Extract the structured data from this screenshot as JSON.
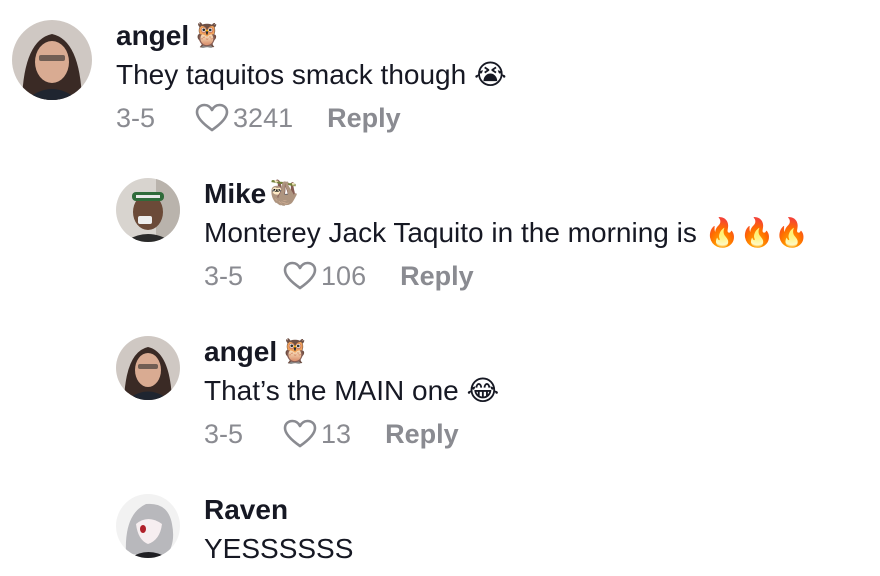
{
  "comments": [
    {
      "username": "angel",
      "badge": "🦉",
      "text": "They taquitos smack though 😭",
      "date": "3-5",
      "likes": "3241",
      "reply_label": "Reply"
    },
    {
      "username": "Mike",
      "badge": "🦥",
      "text": "Monterey Jack Taquito in the morning is 🔥🔥🔥",
      "date": "3-5",
      "likes": "106",
      "reply_label": "Reply"
    },
    {
      "username": "angel",
      "badge": "🦉",
      "text": "That’s the MAIN one 😂",
      "date": "3-5",
      "likes": "13",
      "reply_label": "Reply"
    },
    {
      "username": "Raven",
      "badge": "",
      "text": "YESSSSSS"
    }
  ],
  "colors": {
    "primary_text": "#161823",
    "secondary_text": "#8a8b91"
  },
  "icons": {
    "like": "heart-outline-icon"
  }
}
